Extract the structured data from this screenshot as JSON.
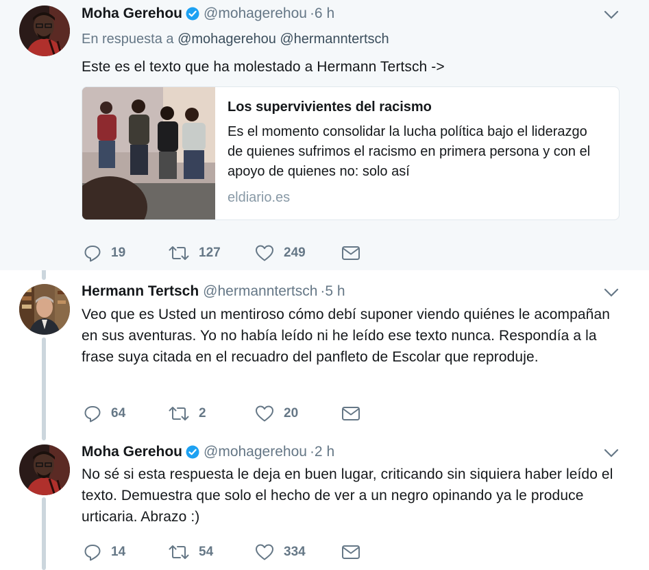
{
  "tweets": [
    {
      "fullname": "Moha Gerehou",
      "verified": true,
      "handle": "@mohagerehou",
      "time": "·6 h",
      "reply_prefix": "En respuesta a",
      "reply_mentions": "@mohagerehou @hermanntertsch",
      "text": "Este es el texto que ha molestado a Hermann Tertsch ->",
      "card": {
        "title": "Los supervivientes del racismo",
        "description": "Es el momento consolidar la lucha política bajo el liderazgo de quienes sufrimos el racismo en primera persona y con el apoyo de quienes no: solo así",
        "domain": "eldiario.es"
      },
      "actions": {
        "replies": "19",
        "retweets": "127",
        "likes": "249"
      }
    },
    {
      "fullname": "Hermann Tertsch",
      "verified": false,
      "handle": "@hermanntertsch",
      "time": "·5 h",
      "text": "Veo que es Usted un mentiroso cómo debí suponer viendo quiénes le acompañan en sus aventuras. Yo no había leído ni he leído ese texto nunca. Respondía a la frase suya citada en el recuadro del panfleto de Escolar que reproduje.",
      "actions": {
        "replies": "64",
        "retweets": "2",
        "likes": "20"
      }
    },
    {
      "fullname": "Moha Gerehou",
      "verified": true,
      "handle": "@mohagerehou",
      "time": "·2 h",
      "text": "No sé si esta respuesta le deja en buen lugar, criticando sin siquiera haber leído el texto. Demuestra que solo el hecho de ver a un negro opinando ya le produce urticaria. Abrazo :)",
      "actions": {
        "replies": "14",
        "retweets": "54",
        "likes": "334"
      }
    }
  ],
  "icons": {
    "reply": "reply-icon",
    "retweet": "retweet-icon",
    "like": "heart-icon",
    "dm": "envelope-icon",
    "verified": "verified-badge-icon",
    "caret": "chevron-down-icon"
  },
  "colors": {
    "text": "#14171a",
    "secondary": "#657786",
    "verified": "#1da1f2",
    "thread_line": "#ccd6dd",
    "focused_bg": "#f5f8fa"
  }
}
